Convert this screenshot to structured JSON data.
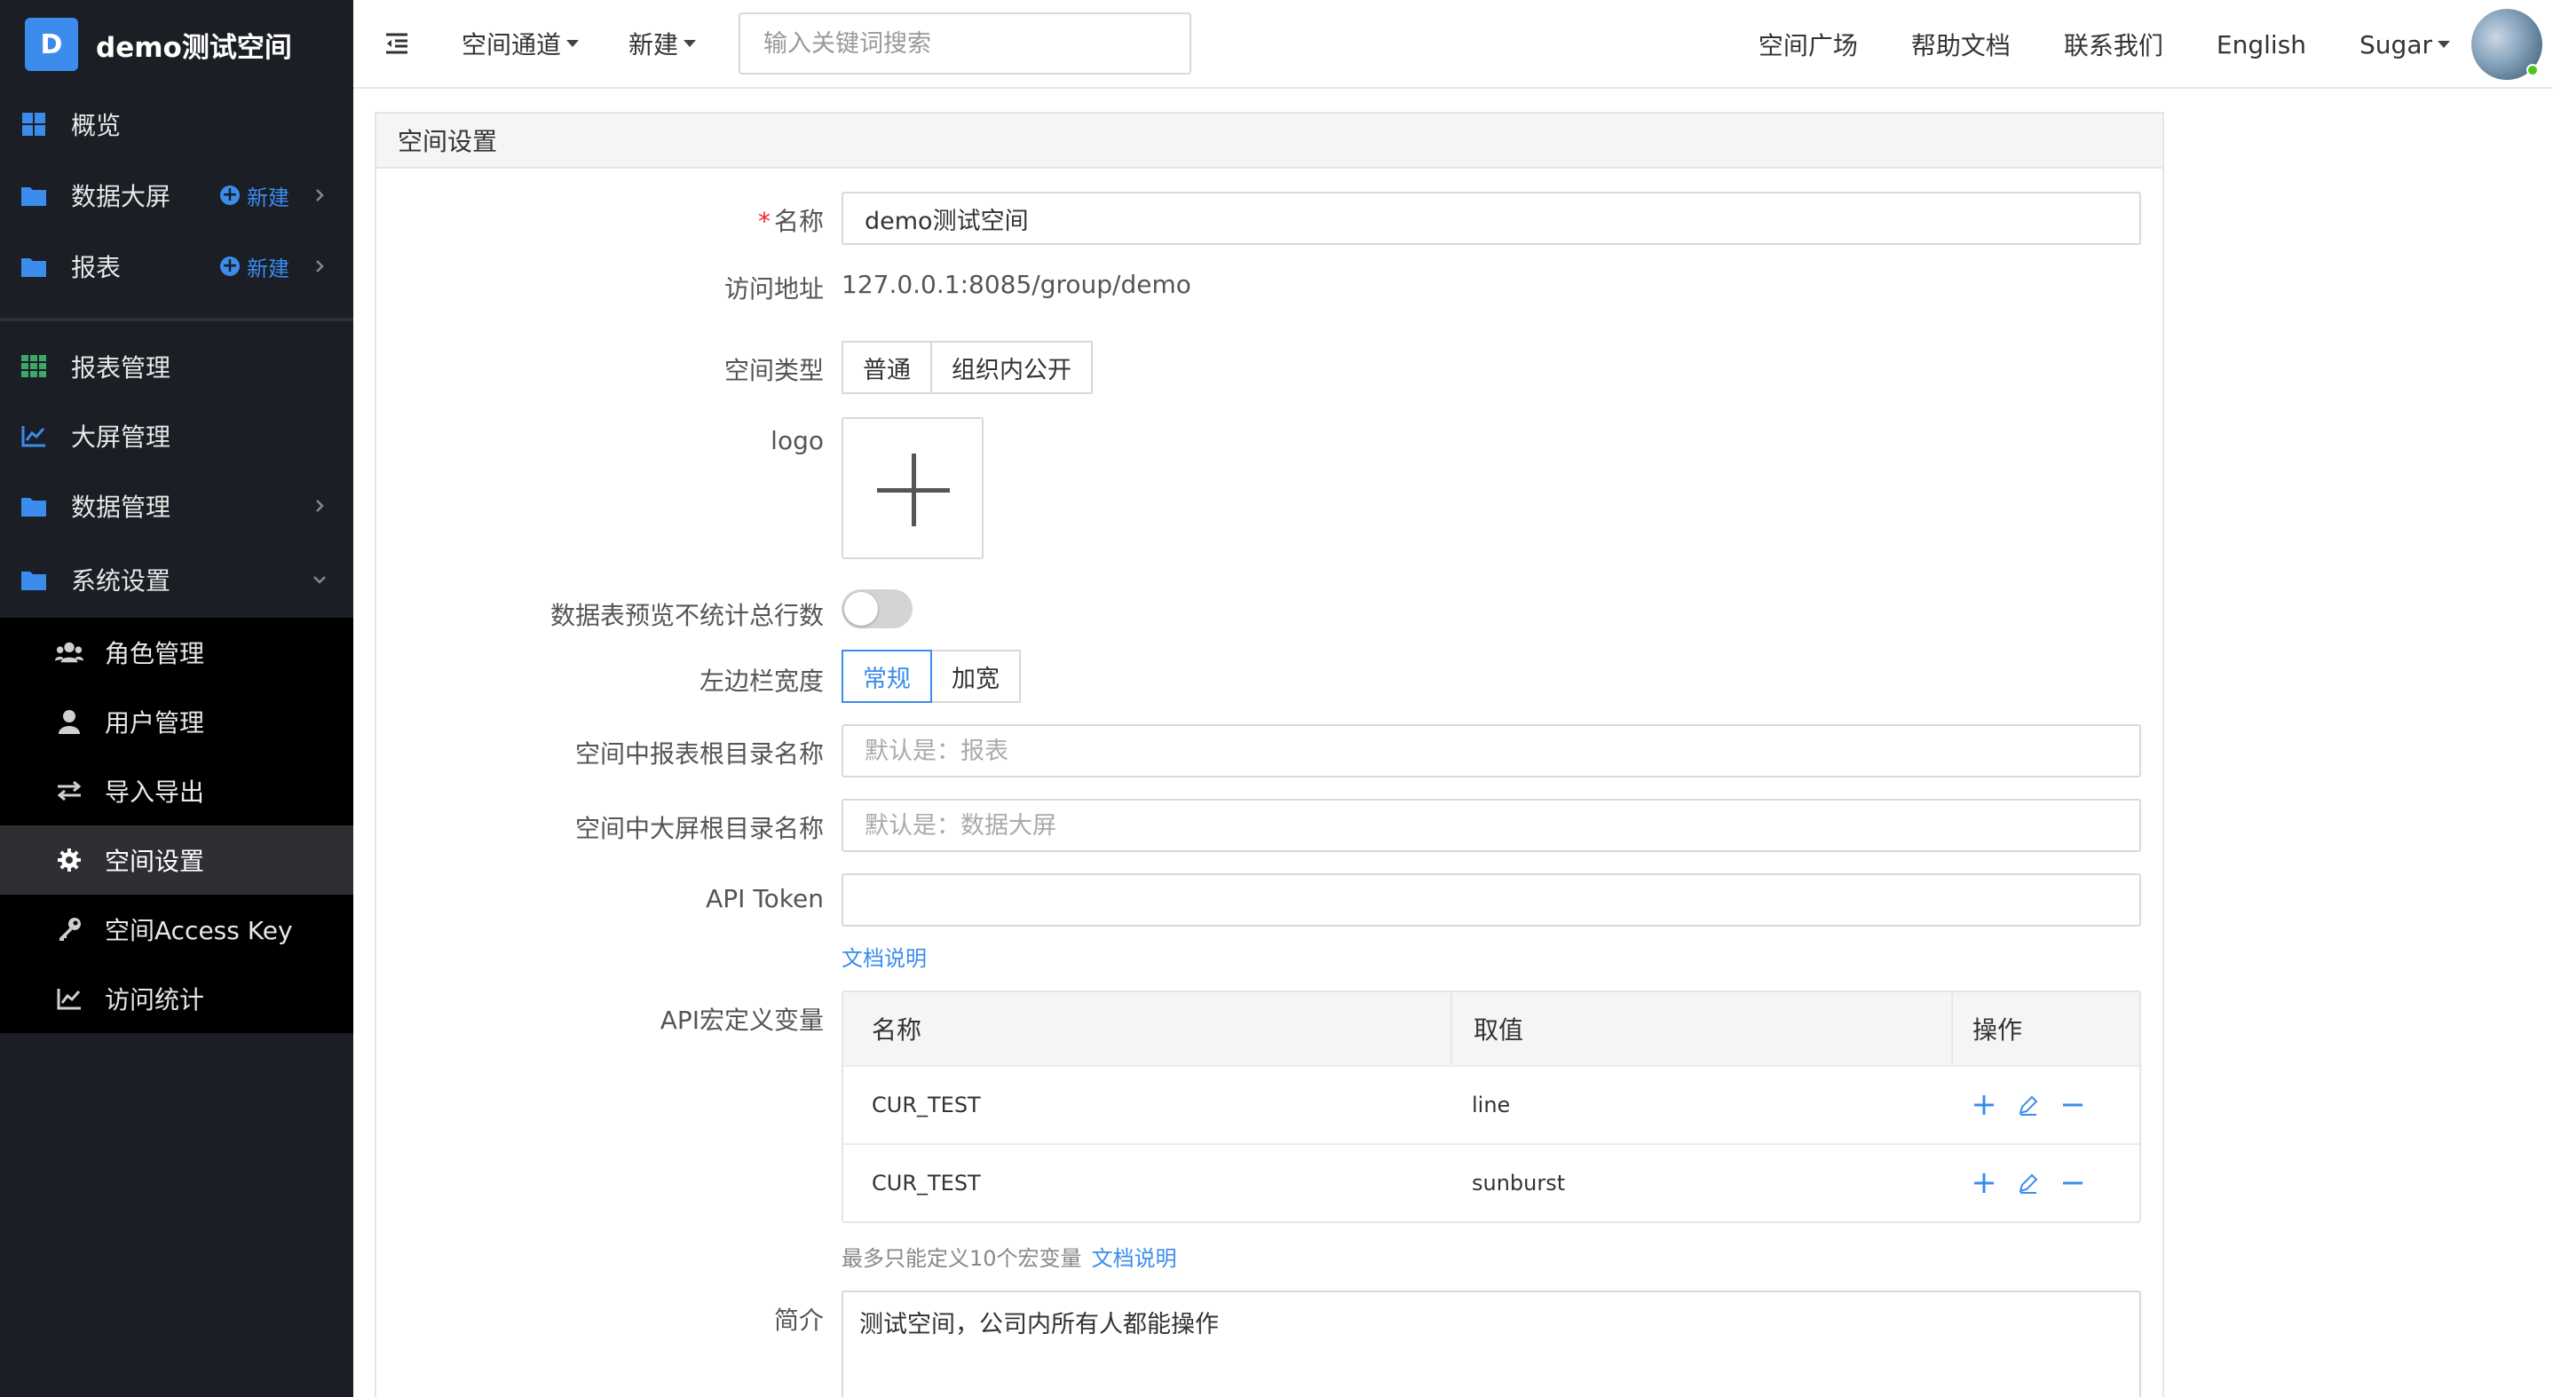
{
  "brand": {
    "logo_letter": "D",
    "title": "demo测试空间"
  },
  "sidebar": {
    "top_items": [
      {
        "label": "概览"
      },
      {
        "label": "数据大屏",
        "new_label": "新建"
      },
      {
        "label": "报表",
        "new_label": "新建"
      }
    ],
    "mgmt_items": [
      {
        "label": "报表管理"
      },
      {
        "label": "大屏管理"
      },
      {
        "label": "数据管理"
      },
      {
        "label": "系统设置"
      }
    ],
    "sub_items": [
      {
        "label": "角色管理"
      },
      {
        "label": "用户管理"
      },
      {
        "label": "导入导出"
      },
      {
        "label": "空间设置"
      },
      {
        "label": "空间Access Key"
      },
      {
        "label": "访问统计"
      }
    ]
  },
  "topbar": {
    "channel": "空间通道",
    "new": "新建",
    "search_placeholder": "输入关键词搜索",
    "links": [
      "空间广场",
      "帮助文档",
      "联系我们",
      "English"
    ],
    "user": "Sugar"
  },
  "panel": {
    "title": "空间设置",
    "name_label": "名称",
    "name_value": "demo测试空间",
    "url_label": "访问地址",
    "url_value": "127.0.0.1:8085/group/demo",
    "type_label": "空间类型",
    "type_options": [
      "普通",
      "组织内公开"
    ],
    "logo_label": "logo",
    "preview_label": "数据表预览不统计总行数",
    "sidebar_width_label": "左边栏宽度",
    "sidebar_width_options": [
      "常规",
      "加宽"
    ],
    "report_root_label": "空间中报表根目录名称",
    "report_root_placeholder": "默认是：报表",
    "screen_root_label": "空间中大屏根目录名称",
    "screen_root_placeholder": "默认是：数据大屏",
    "token_label": "API Token",
    "token_value": "",
    "doc_link": "文档说明",
    "macro_label": "API宏定义变量",
    "macro_headers": [
      "名称",
      "取值",
      "操作"
    ],
    "macro_rows": [
      {
        "name": "CUR_TEST",
        "value": "line"
      },
      {
        "name": "CUR_TEST",
        "value": "sunburst"
      }
    ],
    "macro_hint": "最多只能定义10个宏变量",
    "macro_doc_link": "文档说明",
    "intro_label": "简介",
    "intro_value": "测试空间，公司内所有人都能操作"
  },
  "colors": {
    "accent": "#3b8ced",
    "sidebar_bg": "#1b1e24",
    "required": "#f5222d"
  }
}
